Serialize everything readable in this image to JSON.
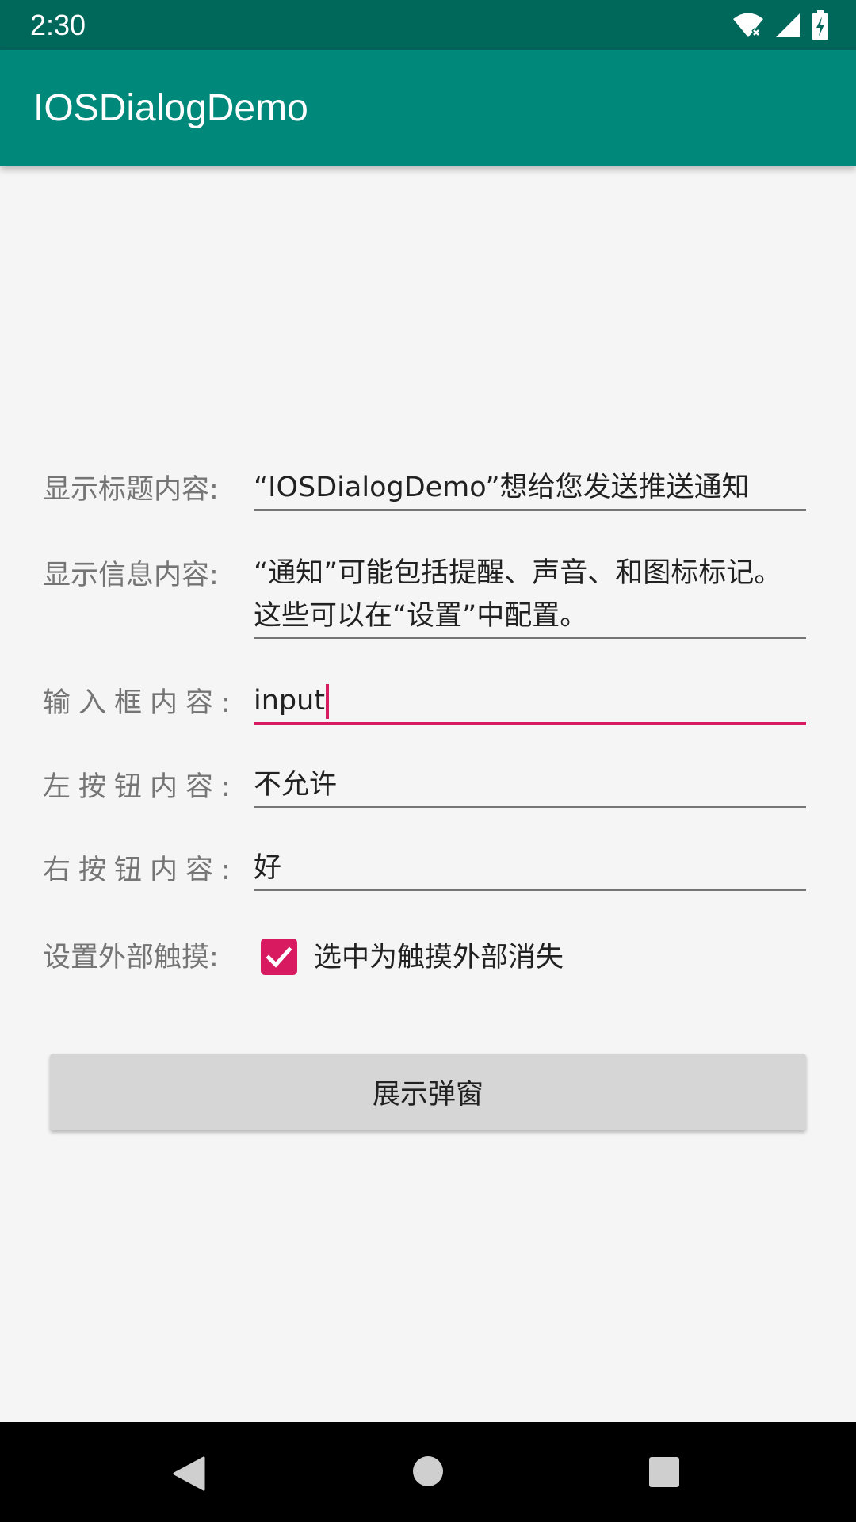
{
  "status_bar": {
    "time": "2:30",
    "icons": [
      "wifi-icon",
      "cell-signal-icon",
      "battery-charging-icon"
    ],
    "color": "#00675b"
  },
  "app_bar": {
    "title": "IOSDialogDemo",
    "color": "#00897b"
  },
  "form": {
    "title_row": {
      "label": "显示标题内容:",
      "value": "“IOSDialogDemo”想给您发送推送通知"
    },
    "message_row": {
      "label": "显示信息内容:",
      "value_line1": "“通知”可能包括提醒、声音、和图标标记。",
      "value_line2": "这些可以在“设置”中配置。"
    },
    "input_row": {
      "label": "输入框内容:",
      "value": "input"
    },
    "left_button_row": {
      "label": "左按钮内容:",
      "value": "不允许"
    },
    "right_button_row": {
      "label": "右按钮内容:",
      "value": "好"
    },
    "touch_outside_row": {
      "label": "设置外部触摸:",
      "checked": true,
      "checkbox_text": "选中为触摸外部消失"
    }
  },
  "show_button": {
    "label": "展示弹窗"
  },
  "nav_bar": {
    "icons": [
      "back-icon",
      "home-icon",
      "recents-icon"
    ]
  },
  "colors": {
    "accent": "#d81b60",
    "primary": "#00897b",
    "primary_dark": "#00675b"
  }
}
